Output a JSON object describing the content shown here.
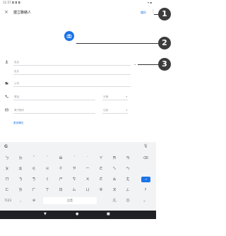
{
  "status_bar": {
    "time": "11:57",
    "status_icons": "◘ ◘ ◘ ·",
    "right_icons": "▾ ▪"
  },
  "app_bar": {
    "close_icon": "×",
    "title": "建立聯絡人",
    "save_label": "儲存",
    "more_icon": "⋮"
  },
  "form": {
    "photo_icon": "camera",
    "name_placeholder": "姓名",
    "surname_placeholder": "姓氏",
    "company_placeholder": "公司",
    "phone_placeholder": "電話",
    "phone_type": "手機",
    "email_placeholder": "電子郵件",
    "email_type": "住家",
    "more_fields": "更多欄位",
    "chevron": "⌄"
  },
  "keyboard": {
    "row1": [
      "ㄅ",
      "ㄉ",
      "ˇ",
      "ˋ",
      "ㄓ",
      "ˊ",
      "˙",
      "ㄚ",
      "ㄞ",
      "ㄢ",
      "⌫"
    ],
    "row2": [
      "ㄆ",
      "ㄊ",
      "ㄍ",
      "ㄐ",
      "ㄔ",
      "ㄗ",
      "ㄧ",
      "ㄛ",
      "ㄟ",
      "ㄣ"
    ],
    "row3": [
      "ㄇ",
      "ㄋ",
      "ㄎ",
      "ㄑ",
      "ㄕ",
      "ㄘ",
      "ㄨ",
      "ㄜ",
      "ㄠ",
      "ㄤ",
      "⏎"
    ],
    "row4": [
      "ㄈ",
      "ㄌ",
      "ㄏ",
      "ㄒ",
      "ㄖ",
      "ㄙ",
      "ㄩ",
      "ㄝ",
      "ㄡ",
      "ㄥ",
      "?"
    ],
    "row5": {
      "num": "?123",
      "comma": ",",
      "globe": "⊕",
      "space": "注音",
      "lang": "儿",
      "emoji": "☺",
      "period": "。"
    }
  },
  "nav": {
    "back": "▼",
    "home": "●",
    "recents": "■"
  },
  "callouts": [
    "1",
    "2",
    "3"
  ]
}
